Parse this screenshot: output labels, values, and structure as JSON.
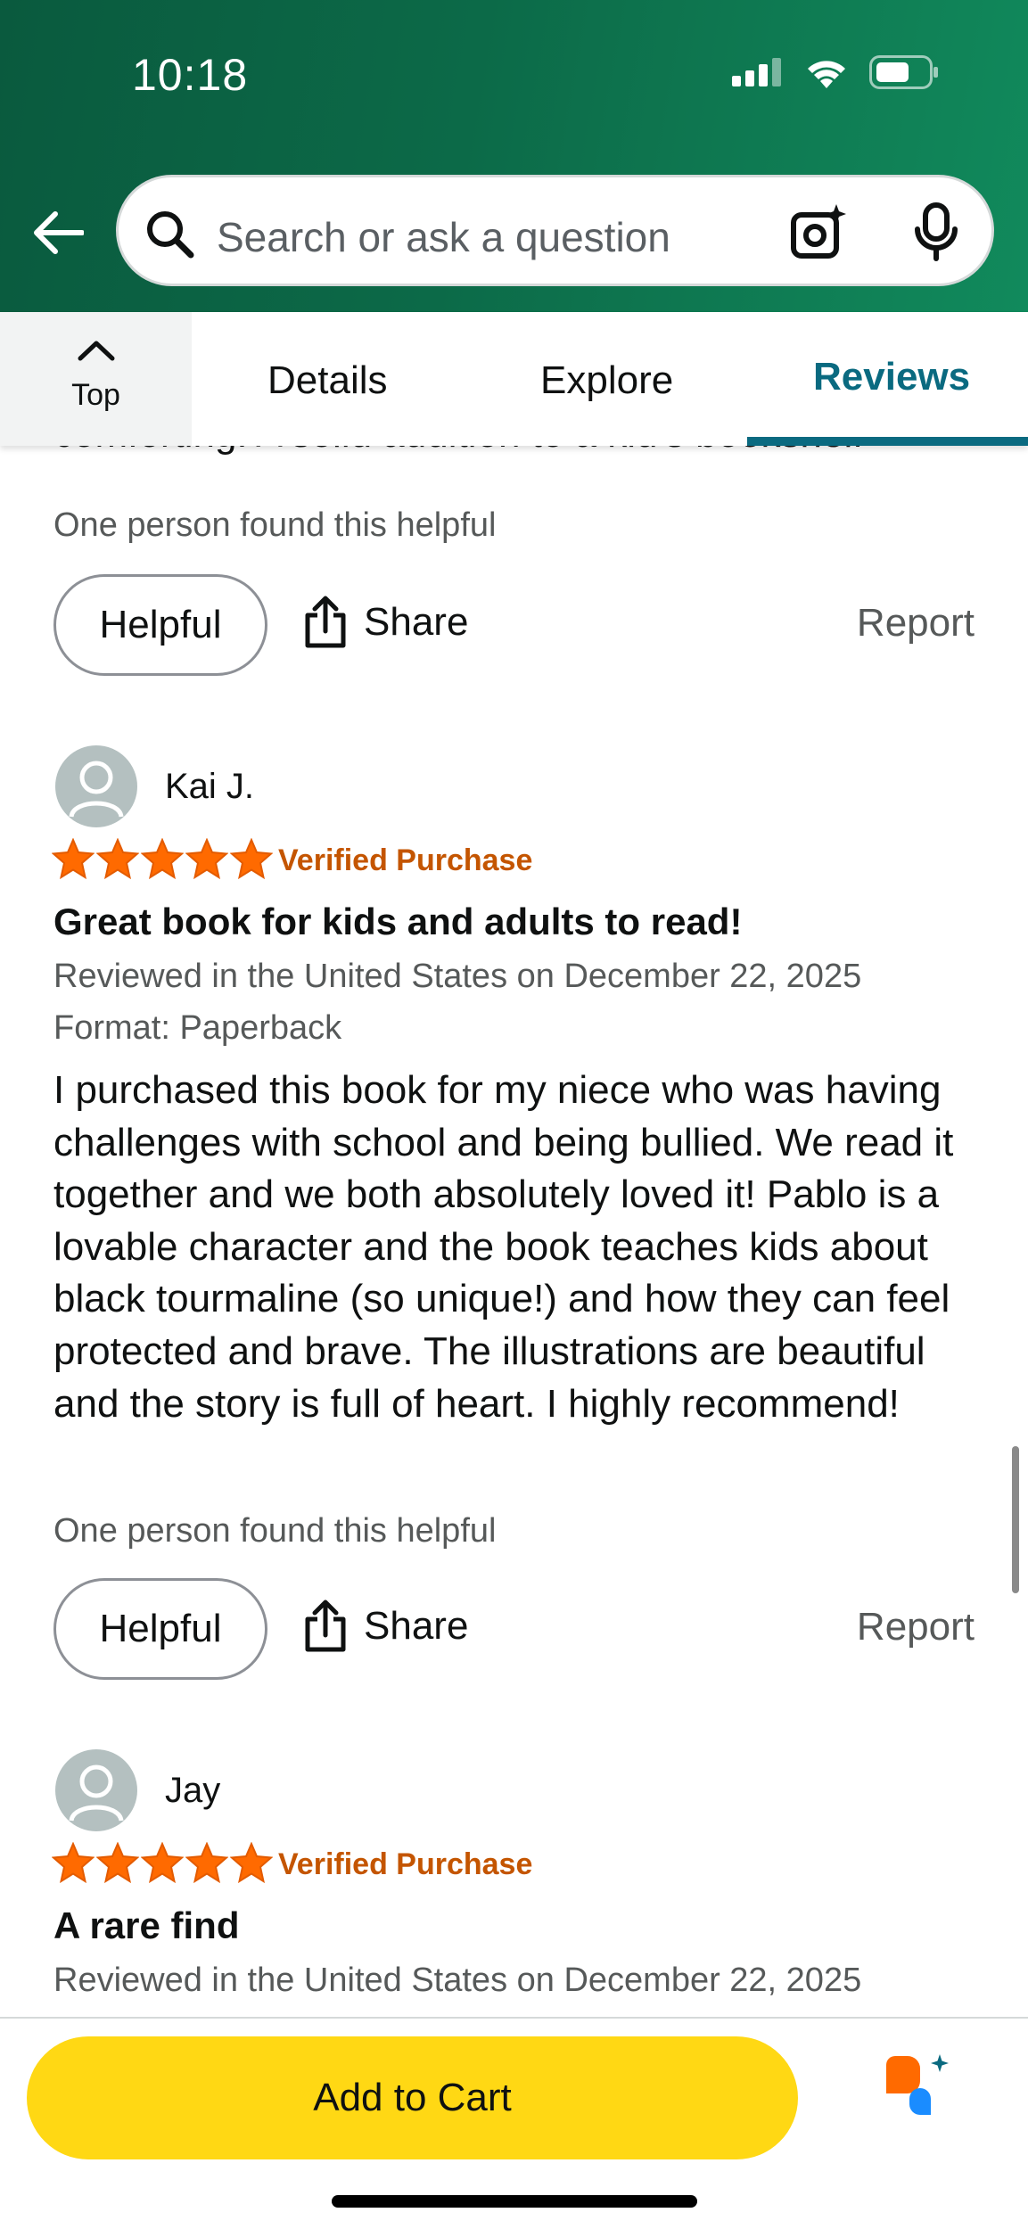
{
  "status_bar": {
    "time": "10:18"
  },
  "search": {
    "placeholder": "Search or ask a question"
  },
  "tabs": {
    "top_label": "Top",
    "details": "Details",
    "explore": "Explore",
    "reviews": "Reviews"
  },
  "prev_review": {
    "partial_text": "comforting. A solid addition to a kid's bookshelf",
    "helpful_count": "One person found this helpful"
  },
  "actions": {
    "helpful": "Helpful",
    "share": "Share",
    "report": "Report"
  },
  "reviews": [
    {
      "reviewer": "Kai J.",
      "rating": 5,
      "verified": "Verified Purchase",
      "title": "Great book for kids and adults to read!",
      "reviewed_in": "Reviewed in the United States on December 22, 2025",
      "format": "Format: Paperback",
      "body": "I purchased this book for my niece who was having challenges with school and being bullied. We read it together and we both absolutely loved it! Pablo is a lovable character and the book teaches kids about black tourmaline (so unique!) and how they can feel protected and brave. The illustrations are beautiful and the story is full of heart. I highly recommend!",
      "helpful_count": "One person found this helpful"
    },
    {
      "reviewer": "Jay",
      "rating": 5,
      "verified": "Verified Purchase",
      "title": "A rare find",
      "reviewed_in": "Reviewed in the United States on December 22, 2025"
    }
  ],
  "cart": {
    "label": "Add to Cart"
  },
  "colors": {
    "header_green": "#0c6a48",
    "accent_teal": "#0a6a80",
    "star_orange": "#ff6a00",
    "verified_orange": "#c45500",
    "cart_yellow": "#ffd814"
  },
  "icons": [
    "back-arrow-icon",
    "search-icon",
    "camera-icon",
    "mic-icon",
    "chevron-up-icon",
    "share-icon",
    "avatar-icon",
    "star-icon",
    "rufus-icon",
    "signal-icon",
    "wifi-icon",
    "battery-icon"
  ]
}
